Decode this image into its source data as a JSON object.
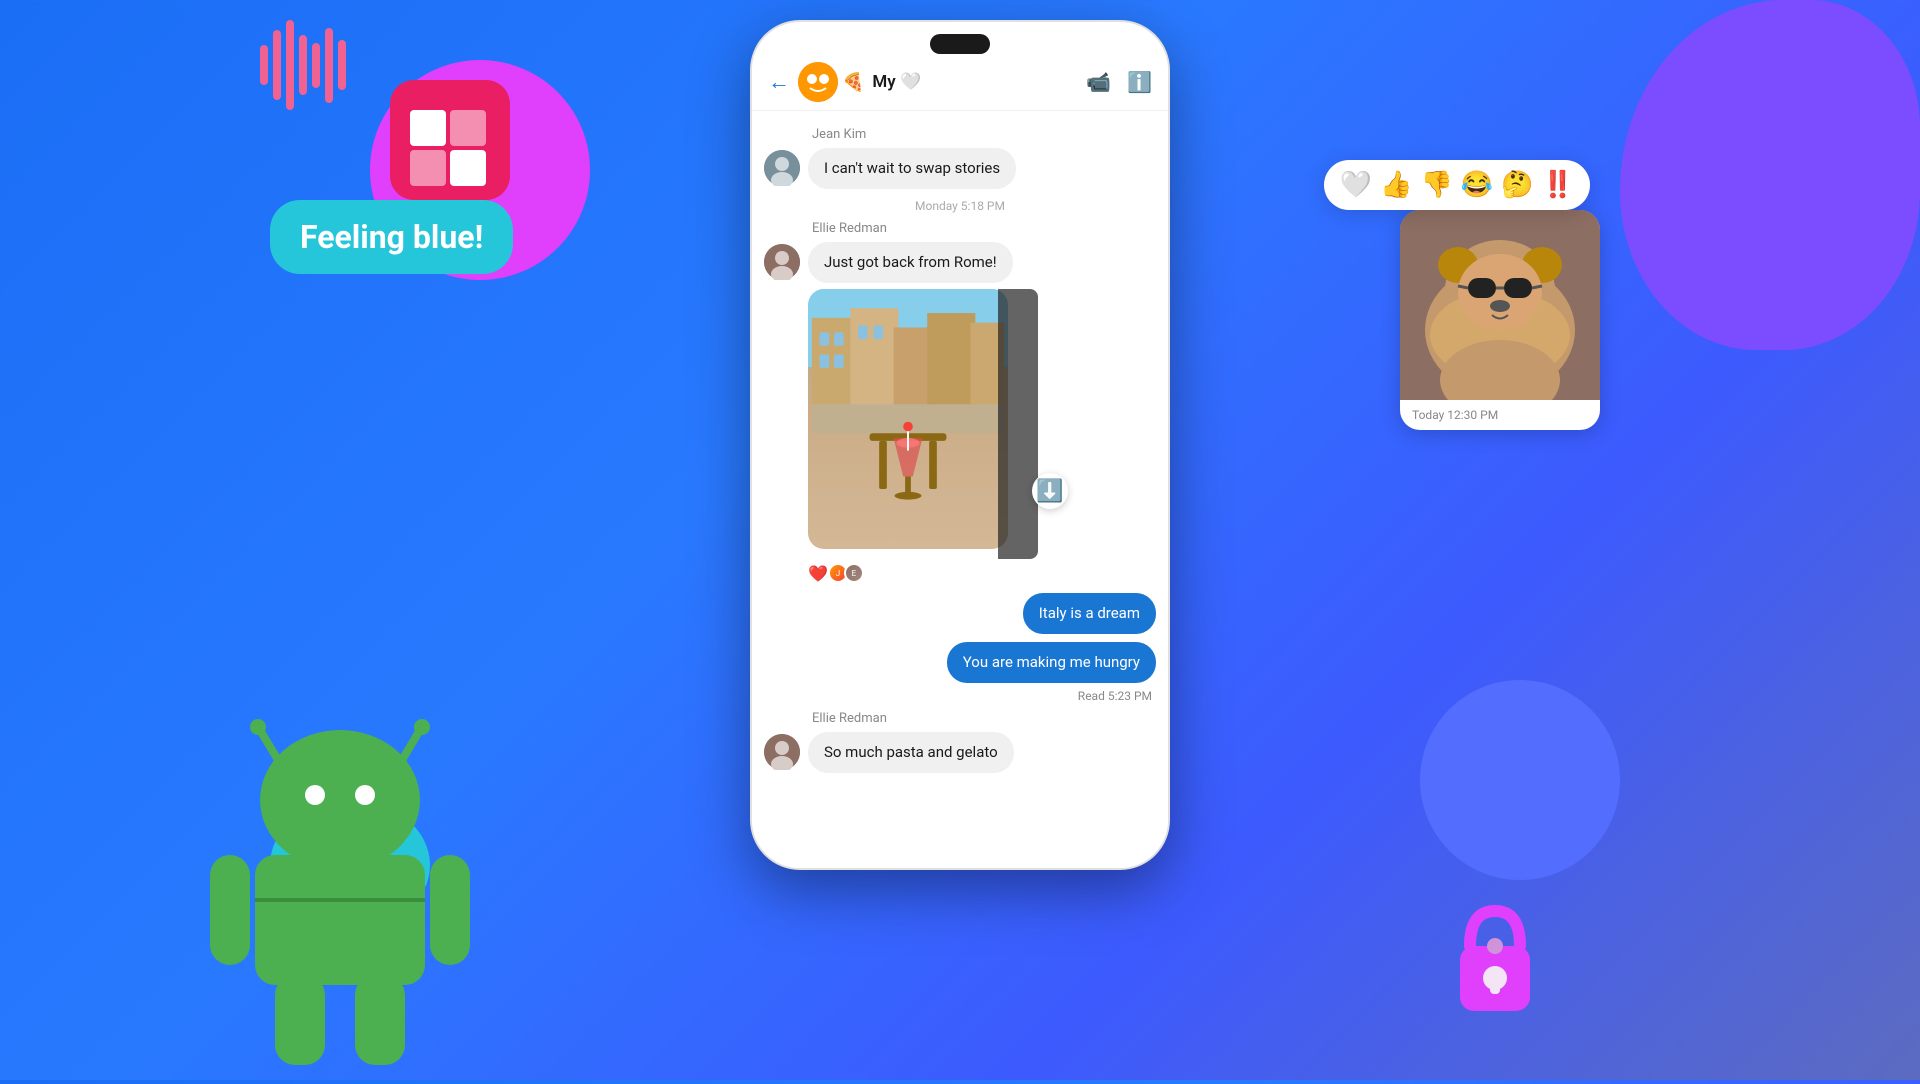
{
  "background": {
    "color": "#2979ff"
  },
  "decorations": {
    "feeling_blue_label": "Feeling blue!",
    "sound_wave_color": "#f06292",
    "app_icon_color": "#e91e63"
  },
  "chat": {
    "header": {
      "back_label": "←",
      "title": "My 🤍",
      "title_prefix": "A 🍕",
      "video_icon": "📹",
      "info_icon": "ℹ️"
    },
    "messages": [
      {
        "sender": "Jean Kim",
        "text": "I can't wait to swap stories",
        "side": "left",
        "avatar": "JK"
      },
      {
        "timestamp": "Monday 5:18 PM"
      },
      {
        "sender": "Ellie Redman",
        "text": "Just got back from Rome!",
        "side": "left",
        "avatar": "ER",
        "has_photo": true
      },
      {
        "text": "Italy is a dream",
        "side": "right"
      },
      {
        "text": "You are making me hungry",
        "side": "right"
      },
      {
        "read_status": "Read  5:23 PM"
      },
      {
        "sender": "Ellie Redman",
        "text": "So much pasta and gelato",
        "side": "left",
        "avatar": "ER"
      }
    ]
  },
  "reactions": {
    "emojis": [
      "🤍",
      "👍",
      "👎",
      "😂",
      "🤔",
      "‼️"
    ]
  },
  "dog_widget": {
    "timestamp": "Today  12:30 PM"
  }
}
